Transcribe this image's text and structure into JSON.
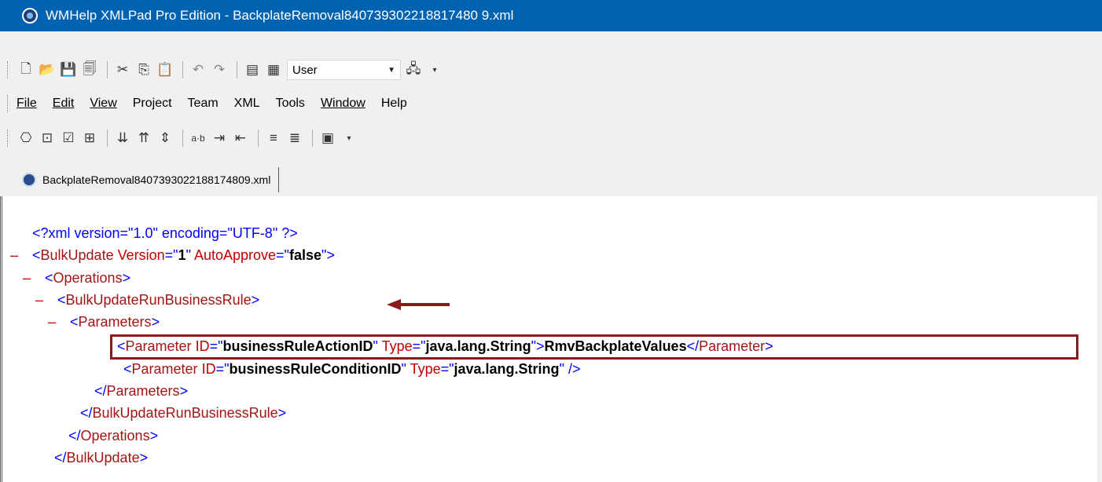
{
  "window": {
    "title": "WMHelp XMLPad Pro Edition - BackplateRemoval840739302218817480 9.xml"
  },
  "toolbar": {
    "combo_value": "User",
    "icons": [
      "new-file-icon",
      "open-folder-icon",
      "save-icon",
      "save-all-icon",
      "cut-icon",
      "copy-icon",
      "paste-icon",
      "undo-icon",
      "redo-icon",
      "view-icon",
      "preview-icon"
    ]
  },
  "menu": {
    "items": [
      "File",
      "Edit",
      "View",
      "Project",
      "Team",
      "XML",
      "Tools",
      "Window",
      "Help"
    ]
  },
  "tabs": [
    {
      "label": "BackplateRemoval8407393022188174809.xml"
    }
  ],
  "editor": {
    "decl": "<?xml version=\"1.0\" encoding=\"UTF-8\" ?>",
    "bulk_tag": "BulkUpdate",
    "version_attr": "Version",
    "version_val": "1",
    "autoapprove_attr": "AutoApprove",
    "autoapprove_val": "false",
    "operations_tag": "Operations",
    "run_rule_tag": "BulkUpdateRunBusinessRule",
    "parameters_tag": "Parameters",
    "parameter_tag": "Parameter",
    "id_attr": "ID",
    "type_attr": "Type",
    "p1_id": "businessRuleActionID",
    "p1_type": "java.lang.String",
    "p1_text": "RmvBackplateValues",
    "p2_id": "businessRuleConditionID",
    "p2_type": "java.lang.String",
    "collapse": "–"
  },
  "colors": {
    "titlebar": "#0063b1",
    "tag": "#a31515",
    "bracket": "#0000ff",
    "annotation": "#8b1a1a"
  }
}
